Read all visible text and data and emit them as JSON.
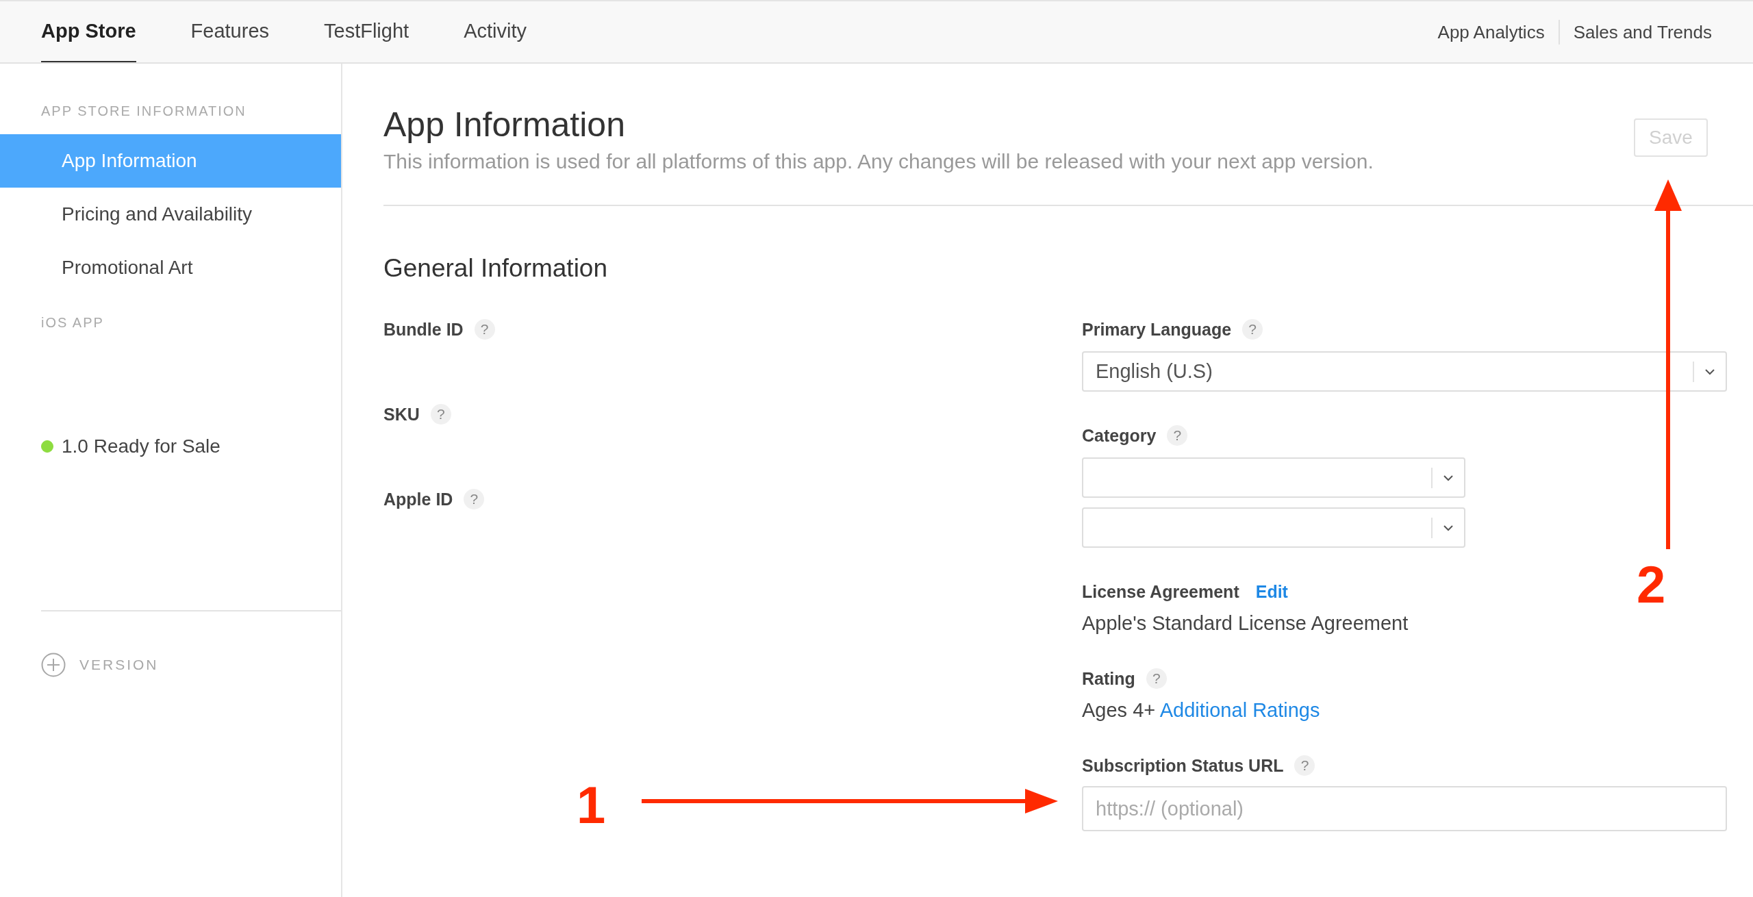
{
  "top_nav": {
    "tabs": [
      {
        "label": "App Store",
        "selected": true
      },
      {
        "label": "Features",
        "selected": false
      },
      {
        "label": "TestFlight",
        "selected": false
      },
      {
        "label": "Activity",
        "selected": false
      }
    ],
    "links": [
      "App Analytics",
      "Sales and Trends"
    ]
  },
  "sidebar": {
    "sections": [
      {
        "heading": "APP STORE INFORMATION",
        "items": [
          {
            "label": "App Information",
            "selected": true
          },
          {
            "label": "Pricing and Availability",
            "selected": false
          },
          {
            "label": "Promotional Art",
            "selected": false
          }
        ]
      },
      {
        "heading": "iOS APP",
        "items": [
          {
            "label": "1.0 Ready for Sale",
            "selected": false,
            "color": "#8ddc3f"
          }
        ]
      }
    ],
    "add_button": {
      "label": "VERSION",
      "disabled": true
    }
  },
  "page": {
    "title": "App Information",
    "subtitle": "This information is used for all platforms of this app. Any changes will be released with your next app version.",
    "save_button": {
      "label": "Save",
      "disabled": true
    }
  },
  "general_information": {
    "heading": "General Information",
    "left_fields": [
      {
        "label": "Bundle ID",
        "help": "?"
      },
      {
        "label": "SKU",
        "help": "?"
      },
      {
        "label": "Apple ID",
        "help": "?"
      }
    ],
    "right_fields": [
      {
        "kind": "select",
        "label": "Primary Language",
        "help": "?",
        "value": "English (U.S)"
      },
      {
        "kind": "category_selects",
        "label": "Category",
        "help": "?"
      },
      {
        "kind": "text",
        "label": "License Agreement",
        "link": "Edit",
        "value": "Apple's Standard License Agreement"
      },
      {
        "kind": "rating",
        "label": "Rating",
        "help": "?",
        "value": "Ages 4+",
        "link": "Additional Ratings"
      },
      {
        "kind": "input",
        "label": "Subscription Status URL",
        "help": "?",
        "placeholder": "https:// (optional)"
      }
    ]
  },
  "annotations": [
    {
      "kind": "arrow_right",
      "label": "1"
    },
    {
      "kind": "arrow_up",
      "label": "2"
    }
  ]
}
